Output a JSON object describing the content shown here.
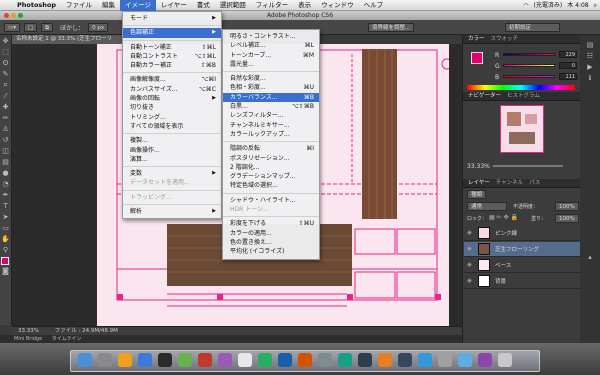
{
  "menubar": {
    "app_name": "Photoshop",
    "items": [
      "ファイル",
      "編集",
      "イメージ",
      "レイヤー",
      "書式",
      "選択範囲",
      "フィルター",
      "表示",
      "ウィンドウ",
      "ヘルプ"
    ],
    "active_index": 2,
    "status_right": [
      "(充電済み)",
      "木 4:08"
    ]
  },
  "window": {
    "title": "Adobe Photoshop CS6"
  },
  "options_bar": {
    "blur_label": "ぼかし：",
    "blur_value": "0 px",
    "select_mask_label": "境界線を調整...",
    "workspace_label": "初期設定"
  },
  "document": {
    "tab_title": "名称未設定 1 @ 33.3% (芝生フローリ",
    "zoom": "33.33%",
    "file_info": "ファイル : 24.9M/48.9M"
  },
  "bottom_tabs": [
    "Mini Bridge",
    "タイムライン"
  ],
  "image_menu": {
    "items": [
      {
        "label": "モード",
        "shortcut": "",
        "submenu": true,
        "state": "normal"
      },
      {
        "sep": true
      },
      {
        "label": "色調補正",
        "shortcut": "",
        "submenu": true,
        "state": "highlight"
      },
      {
        "sep": true
      },
      {
        "label": "自動トーン補正",
        "shortcut": "⇧⌘L",
        "state": "normal"
      },
      {
        "label": "自動コントラスト",
        "shortcut": "⌥⇧⌘L",
        "state": "normal"
      },
      {
        "label": "自動カラー補正",
        "shortcut": "⇧⌘B",
        "state": "normal"
      },
      {
        "sep": true
      },
      {
        "label": "画像解像度...",
        "shortcut": "⌥⌘I",
        "state": "normal"
      },
      {
        "label": "カンバスサイズ...",
        "shortcut": "⌥⌘C",
        "state": "normal"
      },
      {
        "label": "画像の回転",
        "shortcut": "",
        "submenu": true,
        "state": "normal"
      },
      {
        "label": "切り抜き",
        "shortcut": "",
        "state": "normal"
      },
      {
        "label": "トリミング...",
        "shortcut": "",
        "state": "normal"
      },
      {
        "label": "すべての領域を表示",
        "shortcut": "",
        "state": "normal"
      },
      {
        "sep": true
      },
      {
        "label": "複製...",
        "shortcut": "",
        "state": "normal"
      },
      {
        "label": "画像操作...",
        "shortcut": "",
        "state": "normal"
      },
      {
        "label": "演算...",
        "shortcut": "",
        "state": "normal"
      },
      {
        "sep": true
      },
      {
        "label": "変数",
        "shortcut": "",
        "submenu": true,
        "state": "normal"
      },
      {
        "label": "データセットを適用...",
        "shortcut": "",
        "state": "disabled"
      },
      {
        "sep": true
      },
      {
        "label": "トラッピング...",
        "shortcut": "",
        "state": "disabled"
      },
      {
        "sep": true
      },
      {
        "label": "解析",
        "shortcut": "",
        "submenu": true,
        "state": "normal"
      }
    ]
  },
  "adjust_submenu": {
    "items": [
      {
        "label": "明るさ・コントラスト...",
        "shortcut": "",
        "state": "normal"
      },
      {
        "label": "レベル補正...",
        "shortcut": "⌘L",
        "state": "normal"
      },
      {
        "label": "トーンカーブ...",
        "shortcut": "⌘M",
        "state": "normal"
      },
      {
        "label": "露光量...",
        "shortcut": "",
        "state": "normal"
      },
      {
        "sep": true
      },
      {
        "label": "自然な彩度...",
        "shortcut": "",
        "state": "normal"
      },
      {
        "label": "色相・彩度...",
        "shortcut": "⌘U",
        "state": "normal"
      },
      {
        "label": "カラーバランス...",
        "shortcut": "⌘B",
        "state": "highlight"
      },
      {
        "label": "白黒...",
        "shortcut": "⌥⇧⌘B",
        "state": "normal"
      },
      {
        "label": "レンズフィルター...",
        "shortcut": "",
        "state": "normal"
      },
      {
        "label": "チャンネルミキサー...",
        "shortcut": "",
        "state": "normal"
      },
      {
        "label": "カラールックアップ...",
        "shortcut": "",
        "state": "normal"
      },
      {
        "sep": true
      },
      {
        "label": "階調の反転",
        "shortcut": "⌘I",
        "state": "normal"
      },
      {
        "label": "ポスタリゼーション...",
        "shortcut": "",
        "state": "normal"
      },
      {
        "label": "2 階調化...",
        "shortcut": "",
        "state": "normal"
      },
      {
        "label": "グラデーションマップ...",
        "shortcut": "",
        "state": "normal"
      },
      {
        "label": "特定色域の選択...",
        "shortcut": "",
        "state": "normal"
      },
      {
        "sep": true
      },
      {
        "label": "シャドウ・ハイライト...",
        "shortcut": "",
        "state": "normal"
      },
      {
        "label": "HDR トーン...",
        "shortcut": "",
        "state": "disabled"
      },
      {
        "sep": true
      },
      {
        "label": "彩度を下げる",
        "shortcut": "⇧⌘U",
        "state": "normal"
      },
      {
        "label": "カラーの適用...",
        "shortcut": "",
        "state": "normal"
      },
      {
        "label": "色の置き換え...",
        "shortcut": "",
        "state": "normal"
      },
      {
        "label": "平均化 (イコライズ)",
        "shortcut": "",
        "state": "normal"
      }
    ]
  },
  "color_panel": {
    "tabs": [
      "カラー",
      "スウォッチ"
    ],
    "channels": [
      {
        "label": "R",
        "value": "229"
      },
      {
        "label": "G",
        "value": "0"
      },
      {
        "label": "B",
        "value": "111"
      }
    ],
    "fg_color": "#e5006f"
  },
  "navigator_panel": {
    "tabs": [
      "ナビゲーター",
      "ヒストグラム"
    ],
    "zoom": "33.33%"
  },
  "layers_panel": {
    "tabs": [
      "レイヤー",
      "チャンネル",
      "パス"
    ],
    "kind_label": "種類",
    "blend_mode": "通常",
    "opacity_label": "不透明度：",
    "opacity_value": "100%",
    "lock_label": "ロック：",
    "fill_label": "塗り：",
    "fill_value": "100%",
    "layers": [
      {
        "name": "ピンク線",
        "selected": false
      },
      {
        "name": "芝生フローリング",
        "selected": true
      },
      {
        "name": "ベース",
        "selected": false
      },
      {
        "name": "背景",
        "selected": false
      }
    ]
  }
}
